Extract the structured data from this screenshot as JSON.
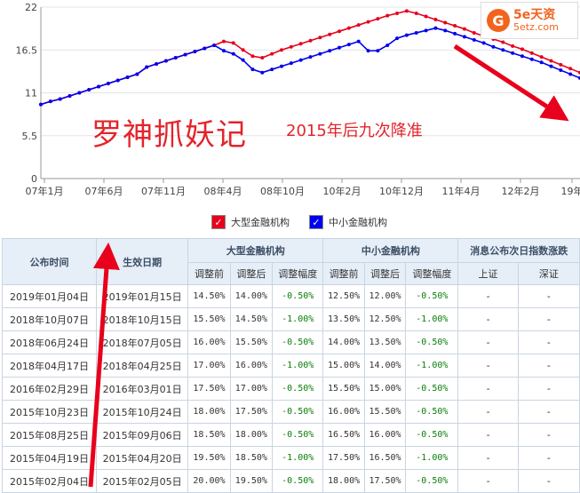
{
  "chart_data": {
    "type": "line",
    "x_tick_labels": [
      "07年1月",
      "07年6月",
      "07年11月",
      "08年4月",
      "08年10月",
      "10年2月",
      "10年12月",
      "11年4月",
      "12年2月",
      "19年"
    ],
    "y_tick_labels": [
      "0",
      "5.5",
      "11",
      "16.5",
      "22"
    ],
    "ylim": [
      0,
      22
    ],
    "grid": "horizontal",
    "legend_position": "bottom",
    "series": [
      {
        "name": "大型金融机构",
        "color": "#e8001c",
        "values": [
          9.5,
          9.9,
          10.2,
          10.6,
          11.0,
          11.4,
          11.8,
          12.2,
          12.6,
          13.0,
          13.4,
          14.3,
          14.7,
          15.1,
          15.5,
          15.9,
          16.3,
          16.7,
          17.1,
          17.6,
          17.4,
          16.5,
          15.7,
          15.5,
          16.0,
          16.5,
          16.9,
          17.3,
          17.7,
          18.1,
          18.5,
          18.9,
          19.3,
          19.7,
          20.1,
          20.5,
          20.9,
          21.2,
          21.5,
          21.2,
          20.8,
          20.4,
          20.0,
          19.6,
          19.2,
          18.7,
          18.3,
          17.9,
          17.5,
          17.0,
          16.6,
          16.1,
          15.6,
          15.1,
          14.6,
          14.1,
          13.6
        ]
      },
      {
        "name": "中小金融机构",
        "color": "#0000ee",
        "values": [
          9.5,
          9.9,
          10.2,
          10.6,
          11.0,
          11.4,
          11.8,
          12.2,
          12.6,
          13.0,
          13.4,
          14.3,
          14.7,
          15.1,
          15.5,
          15.9,
          16.3,
          16.7,
          17.1,
          16.4,
          16.0,
          15.2,
          14.0,
          13.6,
          14.0,
          14.4,
          14.8,
          15.2,
          15.6,
          16.0,
          16.4,
          16.8,
          17.2,
          17.6,
          16.4,
          16.4,
          17.1,
          18.0,
          18.4,
          18.7,
          19.0,
          19.3,
          19.0,
          18.6,
          18.2,
          17.8,
          17.4,
          16.9,
          16.5,
          16.1,
          15.7,
          15.3,
          14.9,
          14.4,
          13.9,
          13.4,
          12.9
        ]
      }
    ],
    "annotations": [
      "罗神抓妖记",
      "2015年后九次降准"
    ]
  },
  "logo": {
    "mark": "G",
    "brand": "5e天资",
    "domain": "5etz.com"
  },
  "table": {
    "header_top": {
      "announce_date": "公布时间",
      "effective_date": "生效日期",
      "large": "大型金融机构",
      "small": "中小金融机构",
      "index": "消息公布次日指数涨跌"
    },
    "header_sub": [
      "调整前",
      "调整后",
      "调整幅度",
      "调整前",
      "调整后",
      "调整幅度",
      "上证",
      "深证"
    ],
    "rows": [
      [
        "2019年01月04日",
        "2019年01月15日",
        "14.50%",
        "14.00%",
        "-0.50%",
        "12.50%",
        "12.00%",
        "-0.50%",
        "-",
        "-"
      ],
      [
        "2018年10月07日",
        "2018年10月15日",
        "15.50%",
        "14.50%",
        "-1.00%",
        "13.50%",
        "12.50%",
        "-1.00%",
        "-",
        "-"
      ],
      [
        "2018年06月24日",
        "2018年07月05日",
        "16.00%",
        "15.50%",
        "-0.50%",
        "14.00%",
        "13.50%",
        "-0.50%",
        "-",
        "-"
      ],
      [
        "2018年04月17日",
        "2018年04月25日",
        "17.00%",
        "16.00%",
        "-1.00%",
        "15.00%",
        "14.00%",
        "-1.00%",
        "-",
        "-"
      ],
      [
        "2016年02月29日",
        "2016年03月01日",
        "17.50%",
        "17.00%",
        "-0.50%",
        "15.50%",
        "15.00%",
        "-0.50%",
        "-",
        "-"
      ],
      [
        "2015年10月23日",
        "2015年10月24日",
        "18.00%",
        "17.50%",
        "-0.50%",
        "16.00%",
        "15.50%",
        "-0.50%",
        "-",
        "-"
      ],
      [
        "2015年08月25日",
        "2015年09月06日",
        "18.50%",
        "18.00%",
        "-0.50%",
        "16.50%",
        "16.00%",
        "-0.50%",
        "-",
        "-"
      ],
      [
        "2015年04月19日",
        "2015年04月20日",
        "19.50%",
        "18.50%",
        "-1.00%",
        "17.50%",
        "16.50%",
        "-1.00%",
        "-",
        "-"
      ],
      [
        "2015年02月04日",
        "2015年02月05日",
        "20.00%",
        "19.50%",
        "-0.50%",
        "18.00%",
        "17.50%",
        "-0.50%",
        "-",
        "-"
      ]
    ]
  }
}
